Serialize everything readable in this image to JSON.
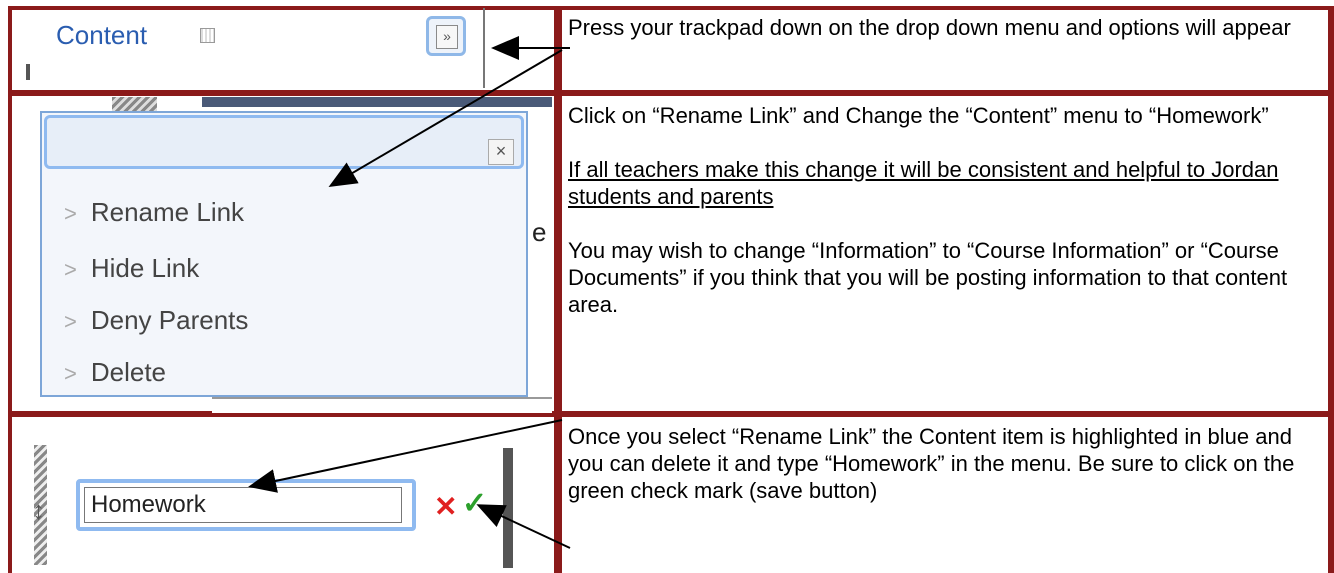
{
  "rows": [
    {
      "screenshot": {
        "menu_title": "Content",
        "drag_handle_icon": "drag-handle-icon",
        "dropdown_icon": "chevron-double-down-icon"
      },
      "instruction": [
        "Press your trackpad down on the drop down menu and options will appear"
      ]
    },
    {
      "screenshot": {
        "close_label": "×",
        "menu_items": [
          "Rename Link",
          "Hide Link",
          "Deny Parents",
          "Delete"
        ],
        "side_fragment": "e"
      },
      "instruction": [
        "Click on “Rename Link” and Change the “Content” menu to “Homework”",
        "If all teachers make this change it will be consistent and helpful to Jordan students and parents",
        " You may wish to change “Information” to “Course Information” or “Course Documents” if you think that you will be posting information to that content area."
      ]
    },
    {
      "screenshot": {
        "input_value": "Homework",
        "cancel_icon": "red-x-icon",
        "save_icon": "green-check-icon"
      },
      "instruction": [
        "Once you select “Rename Link” the Content item is highlighted in blue and you can delete it and type “Homework” in the menu. Be sure to click on the green check mark (save button)"
      ]
    }
  ],
  "colors": {
    "table_border": "#8b1a1a",
    "link_blue": "#2a5db0",
    "highlight_blue": "#8fbaf0",
    "cancel_red": "#e02020",
    "save_green": "#2ca02c"
  }
}
